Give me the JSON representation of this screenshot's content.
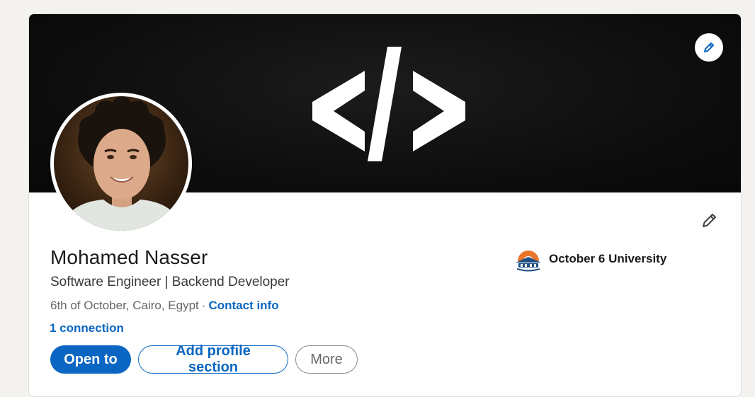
{
  "profile": {
    "name": "Mohamed Nasser",
    "headline": "Software Engineer | Backend Developer",
    "location": "6th of October, Cairo, Egypt",
    "separator": "·",
    "contact_label": "Contact info",
    "connections_label": "1 connection"
  },
  "banner": {
    "icon": "code-brackets-icon",
    "edit_icon": "pencil-icon"
  },
  "education": {
    "name": "October 6 University",
    "logo": "university-logo"
  },
  "actions": {
    "open_to_label": "Open to",
    "add_section_label": "Add profile section",
    "more_label": "More"
  },
  "colors": {
    "accent": "#0a66c2",
    "page_bg": "#f4f2ee",
    "banner_bg": "#111111",
    "logo_orange": "#e8762a",
    "logo_blue": "#1f4f82"
  }
}
